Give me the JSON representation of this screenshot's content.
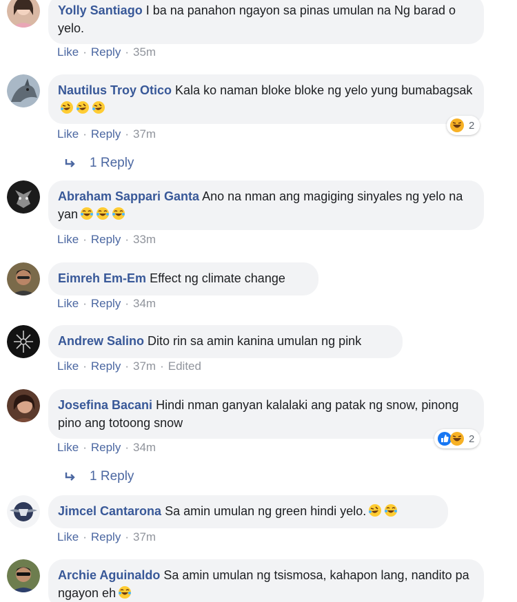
{
  "colors": {
    "author": "#385898",
    "link": "#4b67a1",
    "meta": "#90949c",
    "bubble": "#f2f3f5"
  },
  "action_labels": {
    "like": "Like",
    "reply": "Reply",
    "separator": "·"
  },
  "comments": [
    {
      "author": "Yolly Santiago",
      "text": "I ba na panahon ngayon sa pinas umulan na Ng barad o yelo.",
      "time": "35m",
      "emojis": []
    },
    {
      "author": "Nautilus Troy Otico",
      "text": "Kala ko naman bloke bloke ng yelo yung bumabagsak",
      "time": "37m",
      "emojis": [
        "rofl-emoji",
        "rofl-emoji",
        "rofl-emoji"
      ],
      "reactions": {
        "icons": [
          "haha-reaction-icon"
        ],
        "count": "2"
      },
      "replies": "1 Reply"
    },
    {
      "author": "Abraham Sappari Ganta",
      "text": "Ano na nman ang magiging sinyales ng yelo na yan",
      "time": "33m",
      "emojis": [
        "joy-emoji",
        "joy-emoji",
        "joy-emoji"
      ]
    },
    {
      "author": "Eimreh Em-Em",
      "text": "Effect ng climate change",
      "time": "34m",
      "emojis": []
    },
    {
      "author": "Andrew Salino",
      "text": "Dito rin sa amin kanina umulan ng pink",
      "time": "37m",
      "edited": "Edited",
      "emojis": []
    },
    {
      "author": "Josefina Bacani",
      "text": "Hindi nman ganyan kalalaki ang patak ng snow, pinong pino ang totoong snow",
      "time": "34m",
      "emojis": [],
      "reactions": {
        "icons": [
          "like-reaction-icon",
          "haha-reaction-icon"
        ],
        "count": "2"
      },
      "replies": "1 Reply"
    },
    {
      "author": "Jimcel Cantarona",
      "text": "Sa amin umulan ng green hindi yelo.",
      "time": "37m",
      "emojis": [
        "rofl-emoji",
        "joy-emoji"
      ]
    },
    {
      "author": "Archie Aguinaldo",
      "text": "Sa amin umulan ng tsismosa, kahapon lang, nandito pa ngayon eh",
      "time": "",
      "emojis": [
        "joy-emoji"
      ]
    }
  ]
}
